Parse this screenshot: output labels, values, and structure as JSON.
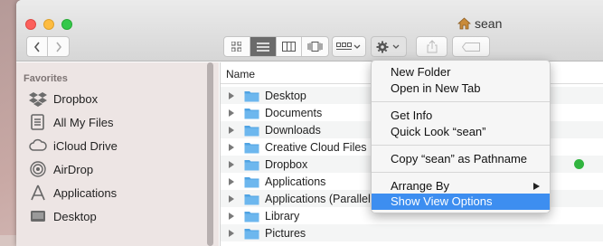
{
  "window": {
    "title": "sean"
  },
  "sidebar": {
    "section": "Favorites",
    "items": [
      {
        "label": "Dropbox",
        "icon": "dropbox-icon"
      },
      {
        "label": "All My Files",
        "icon": "all-files-icon"
      },
      {
        "label": "iCloud Drive",
        "icon": "cloud-icon"
      },
      {
        "label": "AirDrop",
        "icon": "airdrop-icon"
      },
      {
        "label": "Applications",
        "icon": "applications-icon"
      },
      {
        "label": "Desktop",
        "icon": "desktop-icon"
      }
    ]
  },
  "content": {
    "column": "Name",
    "rows": [
      {
        "name": "Desktop"
      },
      {
        "name": "Documents"
      },
      {
        "name": "Downloads"
      },
      {
        "name": "Creative Cloud Files"
      },
      {
        "name": "Dropbox"
      },
      {
        "name": "Applications"
      },
      {
        "name": "Applications (Parallels)"
      },
      {
        "name": "Library"
      },
      {
        "name": "Pictures"
      }
    ]
  },
  "menu": {
    "items": [
      "New Folder",
      "Open in New Tab",
      "Get Info",
      "Quick Look “sean”",
      "Copy “sean” as Pathname",
      "Arrange By",
      "Show View Options"
    ]
  },
  "colors": {
    "highlight": "#3d8ef0",
    "folder": "#4fa3e3"
  }
}
